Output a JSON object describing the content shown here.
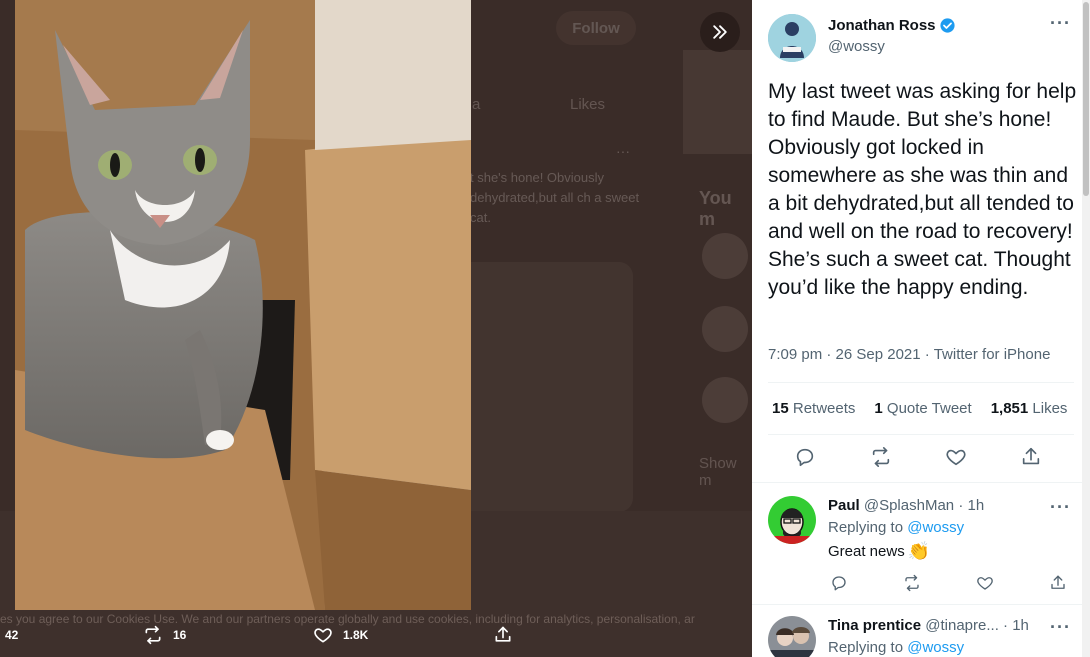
{
  "viewer": {
    "follow_label": "Follow",
    "likes_tab": "Likes",
    "tab_partial": "a",
    "bg_tweet_text": "t she's hone! Obviously dehydrated,but all ch a sweet cat.",
    "you_might_like": "You m",
    "show_more": "Show m",
    "cookie_text": "es you agree to our Cookies Use. We and our partners operate globally and use cookies, including for analytics, personalisation, ar",
    "photo_alt": "Grey tabby cat sitting in a cardboard box",
    "actions": {
      "replies": "42",
      "retweets": "16",
      "likes": "1.8K"
    }
  },
  "tweet": {
    "author_name": "Jonathan Ross",
    "author_handle": "@wossy",
    "verified": true,
    "text": "My last tweet was asking for help to find Maude. But she’s hone! Obviously got locked in somewhere as she was thin and a bit dehydrated,but all tended to and well on the road to recovery! She’s such a sweet cat. Thought you’d like the happy ending.",
    "time": "7:09 pm · 26 Sep 2021",
    "source": "Twitter for iPhone",
    "stats": {
      "retweets_count": "15",
      "retweets_label": "Retweets",
      "quotes_count": "1",
      "quotes_label": "Quote Tweet",
      "likes_count": "1,851",
      "likes_label": "Likes"
    }
  },
  "replies": [
    {
      "name": "Paul",
      "handle": "@SplashMan",
      "time": "1h",
      "replying_label": "Replying to",
      "replying_to": "@wossy",
      "text": "Great news",
      "emoji": "👏"
    },
    {
      "name": "Tina prentice",
      "handle": "@tinapre...",
      "time": "1h",
      "replying_label": "Replying to",
      "replying_to": "@wossy"
    }
  ],
  "colors": {
    "accent": "#1d9bf0",
    "text_primary": "#0f1419",
    "text_secondary": "#536471",
    "overlay": "#3a2c28"
  },
  "icons": [
    "next-arrow-icon",
    "reply-icon",
    "retweet-icon",
    "like-icon",
    "share-icon",
    "more-icon",
    "verified-badge-icon"
  ]
}
